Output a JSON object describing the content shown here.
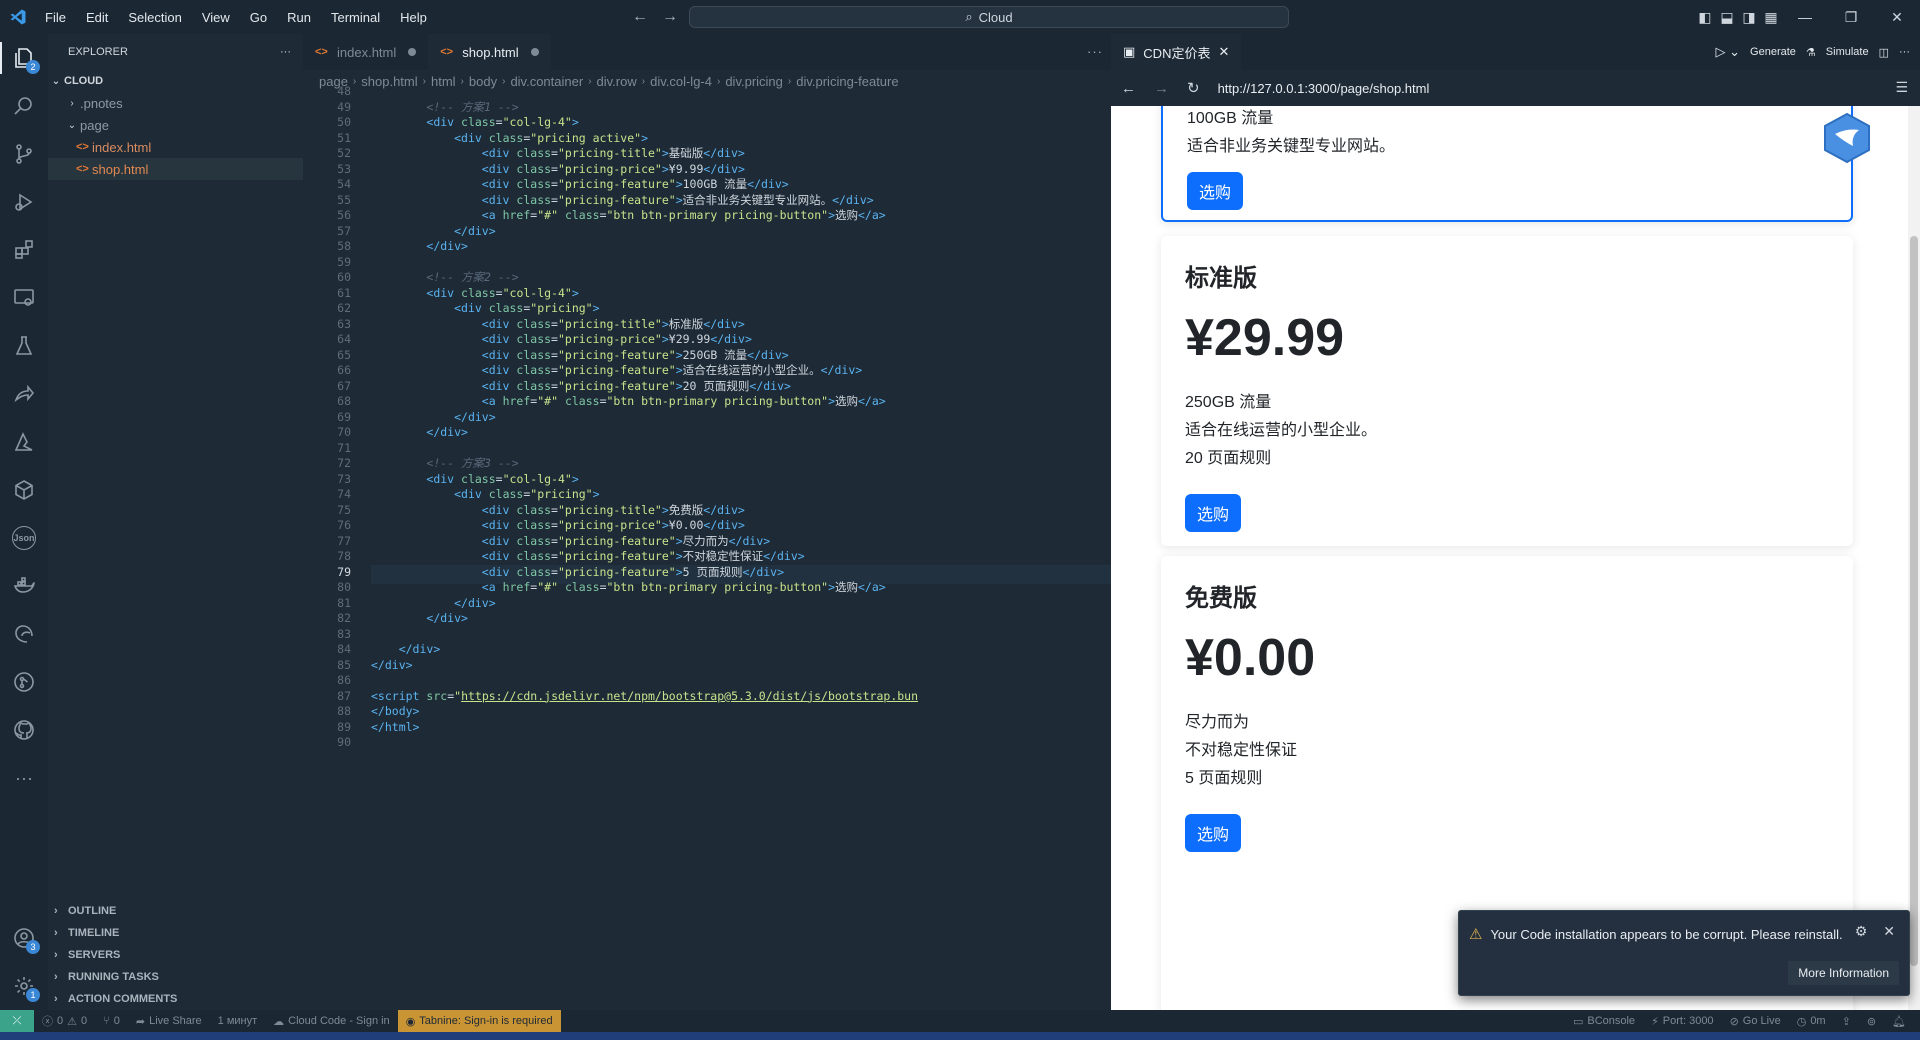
{
  "titlebar": {
    "menu": [
      "File",
      "Edit",
      "Selection",
      "View",
      "Go",
      "Run",
      "Terminal",
      "Help"
    ],
    "search": "Cloud"
  },
  "activity": {
    "explorer_badge": "2",
    "accounts_badge": "3",
    "settings_badge": "1"
  },
  "explorer": {
    "title": "EXPLORER",
    "root": "CLOUD",
    "items": [
      ".pnotes",
      "page",
      "index.html",
      "shop.html"
    ],
    "sections": [
      "OUTLINE",
      "TIMELINE",
      "SERVERS",
      "RUNNING TASKS",
      "ACTION COMMENTS"
    ]
  },
  "editor": {
    "tabs": [
      {
        "label": "index.html"
      },
      {
        "label": "shop.html"
      }
    ],
    "breadcrumbs": [
      "page",
      "shop.html",
      "html",
      "body",
      "div.container",
      "div.row",
      "div.col-lg-4",
      "div.pricing",
      "div.pricing-feature"
    ],
    "current_line": "79",
    "line_numbers": [
      "48",
      "49",
      "50",
      "51",
      "52",
      "53",
      "54",
      "55",
      "56",
      "57",
      "58",
      "59",
      "60",
      "61",
      "62",
      "63",
      "64",
      "65",
      "66",
      "67",
      "68",
      "69",
      "70",
      "71",
      "72",
      "73",
      "74",
      "75",
      "76",
      "77",
      "78",
      "79",
      "80",
      "81",
      "82",
      "83",
      "84",
      "85",
      "86",
      "87",
      "88",
      "89",
      "90"
    ],
    "plans": [
      {
        "comment": "<!-- 方案1 -->",
        "cls": "pricing active",
        "title": "基础版",
        "price": "¥9.99",
        "features": [
          "100GB 流量",
          "适合非业务关键型专业网站。"
        ]
      },
      {
        "comment": "<!-- 方案2 -->",
        "cls": "pricing",
        "title": "标准版",
        "price": "¥29.99",
        "features": [
          "250GB 流量",
          "适合在线运营的小型企业。",
          "20 页面规则"
        ]
      },
      {
        "comment": "<!-- 方案3 -->",
        "cls": "pricing",
        "title": "免费版",
        "price": "¥0.00",
        "features": [
          "尽力而为",
          "不对稳定性保证",
          "5 页面规则"
        ]
      }
    ],
    "button_label": "选购",
    "script_src": "https://cdn.jsdelivr.net/npm/bootstrap@5.3.0/dist/js/bootstrap.bun"
  },
  "preview": {
    "tab_title": "CDN定价表",
    "generate": "Generate",
    "simulate": "Simulate",
    "url": "http://127.0.0.1:3000/page/shop.html",
    "card1": {
      "features": [
        "100GB 流量",
        "适合非业务关键型专业网站。"
      ],
      "button": "选购"
    },
    "card2": {
      "title": "标准版",
      "price": "¥29.99",
      "features": [
        "250GB 流量",
        "适合在线运营的小型企业。",
        "20 页面规则"
      ],
      "button": "选购"
    },
    "card3": {
      "title": "免费版",
      "price": "¥0.00",
      "features": [
        "尽力而为",
        "不对稳定性保证",
        "5 页面规则"
      ],
      "button": "选购"
    }
  },
  "notification": {
    "message": "Your Code installation appears to be corrupt. Please reinstall.",
    "button": "More Information"
  },
  "statusbar": {
    "problems": "0",
    "warnings": "0",
    "ports": "0",
    "live_share": "Live Share",
    "time": "1 минут",
    "cloud_code": "Cloud Code - Sign in",
    "tabnine": "Tabnine: Sign-in is required",
    "bconsole": "BConsole",
    "port": "Port: 3000",
    "go_live": "Go Live",
    "duration": "0m"
  }
}
